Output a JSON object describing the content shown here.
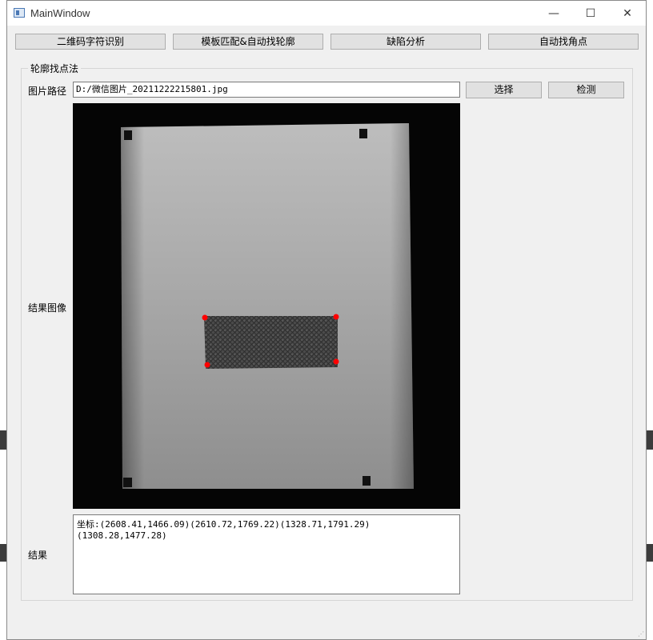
{
  "window": {
    "title": "MainWindow"
  },
  "controls": {
    "minimize": "—",
    "maximize": "☐",
    "close": "✕"
  },
  "top_buttons": [
    "二维码字符识别",
    "模板匹配&自动找轮廓",
    "缺陷分析",
    "自动找角点"
  ],
  "group": {
    "title": "轮廓找点法",
    "path_label": "图片路径",
    "path_value": "D:/微信图片_20211222215801.jpg",
    "select_button": "选择",
    "detect_button": "检测",
    "image_label": "结果图像",
    "result_label": "结果",
    "result_text": "坐标:(2608.41,1466.09)(2610.72,1769.22)(1328.71,1791.29)(1308.28,1477.28)"
  },
  "colors": {
    "corner_marker": "#ff0000",
    "window_bg": "#f0f0f0",
    "button_bg": "#e1e1e1"
  }
}
